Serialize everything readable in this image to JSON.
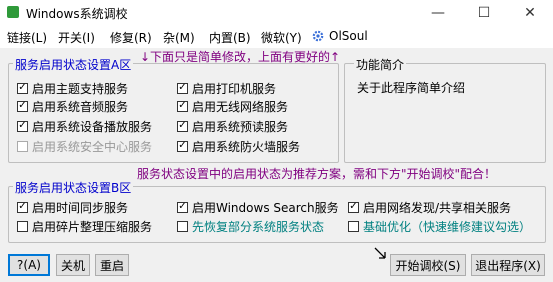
{
  "window": {
    "title": "Windows系统调校",
    "minimize": "—",
    "maximize": "☐",
    "close": "✕"
  },
  "menu": {
    "items": [
      "链接(L)",
      "开关(I)",
      "修复(R)",
      "杂(M)",
      "内置(B)",
      "微软(Y)",
      "OlSoul"
    ]
  },
  "notice_top": "↓下面只是简单修改，上面有更好的↑",
  "group_a": {
    "legend": "服务启用状态设置A区",
    "items": [
      {
        "label": "启用主题支持服务",
        "checked": "✓"
      },
      {
        "label": "启用系统音频服务",
        "checked": "✓"
      },
      {
        "label": "启用系统设备播放服务",
        "checked": "✓"
      },
      {
        "label": "启用系统安全中心服务",
        "checked": ""
      },
      {
        "label": "启用打印机服务",
        "checked": "✓"
      },
      {
        "label": "启用无线网络服务",
        "checked": "✓"
      },
      {
        "label": "启用系统预读服务",
        "checked": "✓"
      },
      {
        "label": "启用系统防火墙服务",
        "checked": "✓"
      }
    ]
  },
  "intro": {
    "legend": "功能简介",
    "text": "关于此程序简单介绍"
  },
  "notice_mid": "服务状态设置中的启用状态为推荐方案，需和下方\"开始调校\"配合！",
  "group_b": {
    "legend": "服务启用状态设置B区",
    "items": [
      {
        "label": "启用时间同步服务",
        "checked": "✓"
      },
      {
        "label": "启用碎片整理压缩服务",
        "checked": ""
      },
      {
        "label": "启用Windows Search服务",
        "checked": "✓"
      },
      {
        "label": "先恢复部分系统服务状态",
        "checked": ""
      },
      {
        "label": "启用网络发现/共享相关服务",
        "checked": "✓"
      },
      {
        "label": "基础优化（快速维修建议勾选）",
        "checked": ""
      }
    ]
  },
  "buttons": {
    "help": "?(A)",
    "shutdown": "关机",
    "restart": "重启",
    "start": "开始调校(S)",
    "exit": "退出程序(X)"
  },
  "colors": {
    "legend_blue": "#0000cc",
    "notice_purple": "#800080",
    "teal": "#008080"
  }
}
